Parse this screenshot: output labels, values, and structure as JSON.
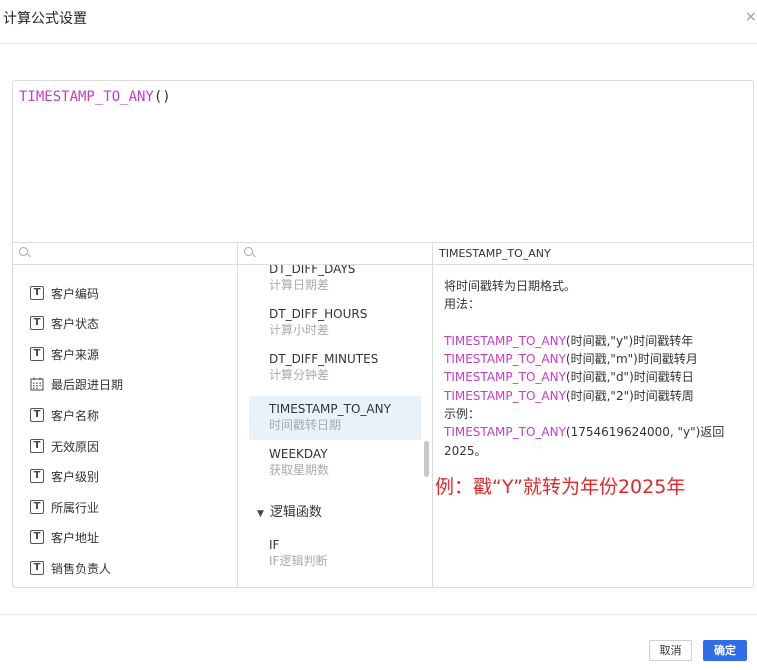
{
  "dialog": {
    "title": "计算公式设置",
    "close_symbol": "×"
  },
  "formula": {
    "function": "TIMESTAMP_TO_ANY",
    "parens": "()"
  },
  "fields": {
    "search_placeholder": "",
    "items": [
      {
        "label": "客户编码",
        "icon": "text-field-icon"
      },
      {
        "label": "客户状态",
        "icon": "text-field-icon"
      },
      {
        "label": "客户来源",
        "icon": "text-field-icon"
      },
      {
        "label": "最后跟进日期",
        "icon": "calendar-field-icon"
      },
      {
        "label": "客户名称",
        "icon": "text-field-icon"
      },
      {
        "label": "无效原因",
        "icon": "text-field-icon"
      },
      {
        "label": "客户级别",
        "icon": "text-field-icon"
      },
      {
        "label": "所属行业",
        "icon": "text-field-icon"
      },
      {
        "label": "客户地址",
        "icon": "text-field-icon"
      },
      {
        "label": "销售负责人",
        "icon": "text-field-icon"
      }
    ],
    "text_icon_glyph": "T"
  },
  "functions": {
    "search_placeholder": "",
    "items": [
      {
        "name": "DT_DIFF_DAYS",
        "desc": "计算日期差"
      },
      {
        "name": "DT_DIFF_HOURS",
        "desc": "计算小时差"
      },
      {
        "name": "DT_DIFF_MINUTES",
        "desc": "计算分钟差"
      },
      {
        "name": "TIMESTAMP_TO_ANY",
        "desc": "时间戳转日期",
        "selected": true
      },
      {
        "name": "WEEKDAY",
        "desc": "获取星期数"
      }
    ],
    "group": {
      "label": "逻辑函数",
      "expanded": true
    },
    "group_items": [
      {
        "name": "IF",
        "desc": "IF逻辑判断"
      }
    ]
  },
  "detail": {
    "title": "TIMESTAMP_TO_ANY",
    "intro": "将时间戳转为日期格式。",
    "usage_label": "用法：",
    "usages": [
      {
        "fn": "TIMESTAMP_TO_ANY",
        "rest": "(时间戳,\"y\")时间戳转年"
      },
      {
        "fn": "TIMESTAMP_TO_ANY",
        "rest": "(时间戳,\"m\")时间戳转月"
      },
      {
        "fn": "TIMESTAMP_TO_ANY",
        "rest": "(时间戳,\"d\")时间戳转日"
      },
      {
        "fn": "TIMESTAMP_TO_ANY",
        "rest": "(时间戳,\"2\")时间戳转周"
      }
    ],
    "example_label": "示例：",
    "example": {
      "fn": "TIMESTAMP_TO_ANY",
      "rest": "(1754619624000, \"y\")返回",
      "result": "2025。"
    }
  },
  "annotation": "例：戳“Y”就转为年份2025年",
  "footer": {
    "cancel_label": "取消",
    "ok_label": "确定"
  },
  "colors": {
    "function_name": "#c83cc8",
    "selected_bg": "#e7f2fb",
    "primary_button": "#2f6ee8",
    "annotation": "#e8262a"
  }
}
